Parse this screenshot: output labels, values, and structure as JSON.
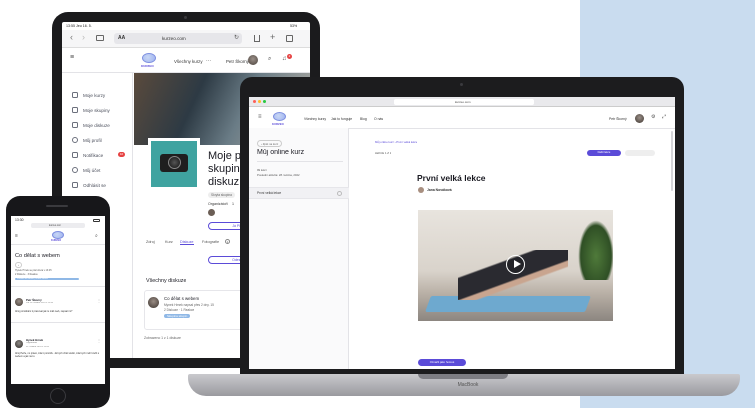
{
  "colors": {
    "accent": "#5b4bd8",
    "panel": "#c9dcef",
    "green": "#3aaf6b",
    "red": "#e64242"
  },
  "brand": "KURZEO",
  "tablet": {
    "status_left": "13:55 Jeu 16. 5.",
    "status_right": "53%",
    "url": "kurzeo.com",
    "aA": "AA",
    "nav_course": "Všechny kurzy",
    "dots": "···",
    "user": "Petr Škorný",
    "notif_count": "2",
    "sidebar": [
      {
        "label": "Moje kurzy",
        "icon": "courses-icon"
      },
      {
        "label": "Moje skupiny",
        "icon": "groups-icon"
      },
      {
        "label": "Moje diskuze",
        "icon": "discussion-icon"
      },
      {
        "label": "Můj profil",
        "icon": "profile-icon"
      },
      {
        "label": "Notifikace",
        "icon": "bell-icon",
        "badge": "10"
      },
      {
        "label": "Můj účet",
        "icon": "gear-icon"
      },
      {
        "label": "Odhlásit se",
        "icon": "logout-icon"
      }
    ],
    "group_title_l1": "Moje p",
    "group_title_l2": "skupin",
    "group_title_l3": "diskuz",
    "group_tag": "Skryta skupina",
    "organizers_label": "Organizátoři",
    "organizers_count": "1",
    "join_label": "Já Plán",
    "tabs": [
      "Zdroj",
      "Kurz",
      "Diskuze",
      "Fotografie"
    ],
    "tab_badge": "1",
    "action_label": "Odeslat",
    "discussion_heading": "Všechny diskuze",
    "disc_title": "Co dělat s webem",
    "disc_line1": "Mynek Hrnek napsal přes 2 dny. 15",
    "disc_line2": "2 Diskuze · 1 Reakce",
    "disc_tag": "Skupina skupin",
    "footer": "Zobrazeno 1 z 1 diskuze"
  },
  "laptop": {
    "url": "kurzeo.com",
    "nav": [
      "Všechny kurzy",
      "Jak to funguje",
      "Blog",
      "O nás"
    ],
    "user": "Petr Škorný",
    "back_label": "‹ Zpět na kurz",
    "course_title": "Můj online kurz",
    "course_meta1": "99 lekcí",
    "course_meta2": "Poslední aktivita: 28. května, 2022",
    "lesson_item": "První velká lekce",
    "breadcrumb": "Můj online kurz  ›  První velká lekce",
    "lesson_count": "LEKCE 1 Z 1",
    "next_label": "Další lekce",
    "lesson_title": "První velká lekce",
    "author": "Jana Nováková",
    "complete_btn": "Označit jako hotové",
    "brand_label": "MacBook"
  },
  "phone": {
    "time": "13:30",
    "url": "kurzeo.com",
    "title": "Co dělat s webem",
    "meta1": "Hynek Hrnek se ptal včera v 13:45",
    "meta2": "2 Diskuze · 3 Reakce",
    "tag": "Zkratka od Hrnka | Hrnek Hrnek",
    "c1_name": "Petr Škorný",
    "c1_date": "Pát 24. května 2024 v 13:59",
    "c1_text": "Ahoj pomáhám ti pracovat jak tu máš web, napsal mi?",
    "c2_name": "Hynek Hrnek",
    "c2_role": "Organizátor",
    "c2_date": "31. května 2024 v 18:26",
    "c2_text": "Ahoj Petře, no právě, zda ti pomůžu. Já bych chtěl vědět, zda bych mohl začít s webem a jak na to."
  }
}
